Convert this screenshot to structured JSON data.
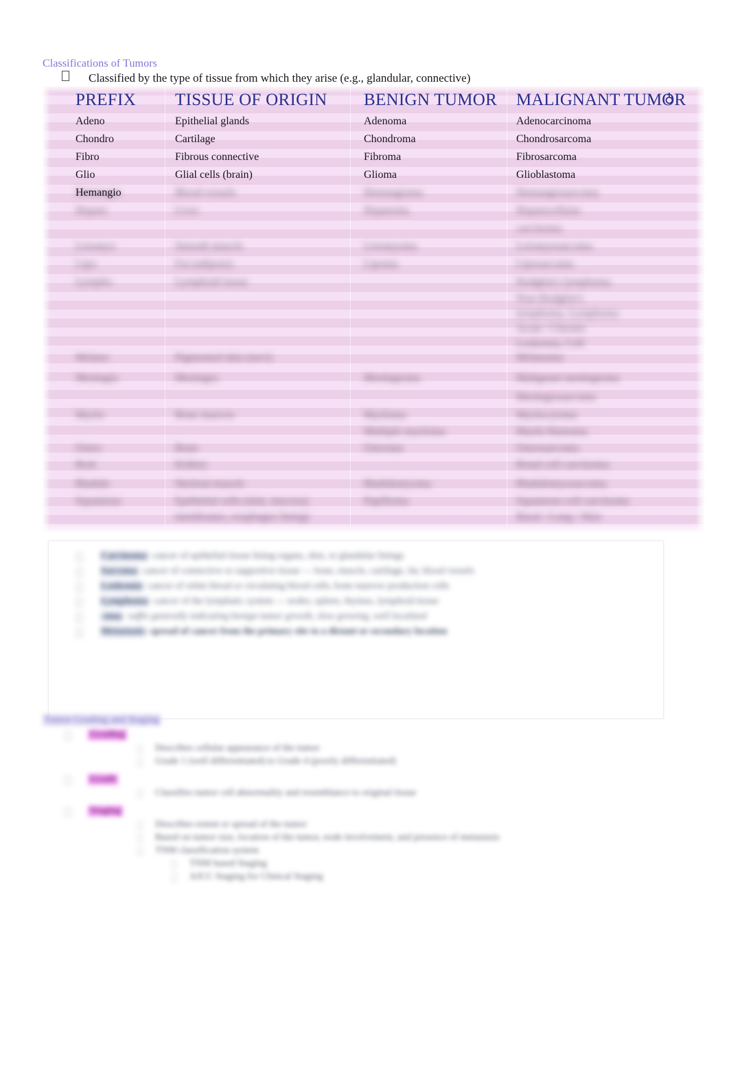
{
  "document": {
    "title": "Classifications of Tumors",
    "intro_bullet_glyph": "tofu-box-glyph",
    "intro_text": "Classified by the type of tissue from which they arise (e.g., glandular, connective)"
  },
  "table": {
    "headers": {
      "prefix": "PREFIX",
      "tissue": "TISSUE OF ORIGIN",
      "benign": "BENIGN TUMOR",
      "malignant": "MALIGNANT TUMOR"
    },
    "glyph_artifact": "♁",
    "rows": [
      {
        "prefix": "Adeno",
        "tissue": "Epithelial glands",
        "benign": "Adenoma",
        "malignant": "Adenocarcinoma"
      },
      {
        "prefix": "Chondro",
        "tissue": "Cartilage",
        "benign": "Chondroma",
        "malignant": "Chondrosarcoma"
      },
      {
        "prefix": "Fibro",
        "tissue": "Fibrous connective",
        "benign": "Fibroma",
        "malignant": "Fibrosarcoma"
      },
      {
        "prefix": "Glio",
        "tissue": "Glial cells (brain)",
        "benign": "Glioma",
        "malignant": "Glioblastoma"
      },
      {
        "prefix": "Hemangio",
        "tissue": "Blood vessels",
        "benign": "Hemangioma",
        "malignant": "Hemangiosarcoma"
      }
    ],
    "obscured_rows": [
      {
        "prefix": "Hepato",
        "tissue": "Liver",
        "benign": "Hepatoma",
        "malignant": "Hepatocellular"
      },
      {
        "prefix": "",
        "tissue": "",
        "benign": "",
        "malignant": "carcinoma"
      },
      {
        "prefix": "Leiomyo",
        "tissue": "Smooth muscle",
        "benign": "Leiomyoma",
        "malignant": "Leiomyosarcoma"
      },
      {
        "prefix": "Lipo",
        "tissue": "Fat (adipose)",
        "benign": "Lipoma",
        "malignant": "Liposarcoma"
      },
      {
        "prefix": "Lympho",
        "tissue": "Lymphoid tissue",
        "benign": "",
        "malignant": "Hodgkin's lymphoma"
      },
      {
        "prefix": "",
        "tissue": "",
        "benign": "",
        "malignant": "Non-Hodgkin's"
      },
      {
        "prefix": "",
        "tissue": "",
        "benign": "",
        "malignant": "lymphoma, Lymphoma"
      },
      {
        "prefix": "",
        "tissue": "",
        "benign": "",
        "malignant": "Acute / Chronic"
      },
      {
        "prefix": "",
        "tissue": "",
        "benign": "",
        "malignant": "Leukemia, Cell"
      },
      {
        "prefix": "Melano",
        "tissue": "Pigmented skin (nevi)",
        "benign": "",
        "malignant": "Melanoma"
      },
      {
        "prefix": "Meningio",
        "tissue": "Meninges",
        "benign": "Meningioma",
        "malignant": "Malignant meningioma"
      },
      {
        "prefix": "",
        "tissue": "",
        "benign": "",
        "malignant": "Meningiosarcoma"
      },
      {
        "prefix": "Myelo",
        "tissue": "Bone marrow",
        "benign": "Myeloma",
        "malignant": "Myelocytoma"
      },
      {
        "prefix": "",
        "tissue": "",
        "benign": "Multiple myeloma",
        "malignant": "Myelo blastoma"
      },
      {
        "prefix": "Osteo",
        "tissue": "Bone",
        "benign": "Osteoma",
        "malignant": "Osteosarcoma"
      },
      {
        "prefix": "Reni",
        "tissue": "Kidney",
        "benign": "",
        "malignant": "Renal cell carcinoma"
      },
      {
        "prefix": "Rhabdo",
        "tissue": "Skeletal muscle",
        "benign": "Rhabdomyoma",
        "malignant": "Rhabdomyosarcoma"
      },
      {
        "prefix": "Squamous",
        "tissue": "Epithelial cells (skin, mucosa)",
        "benign": "Papilloma",
        "malignant": "Squamous cell carcinoma"
      },
      {
        "prefix": "",
        "tissue": "membranes, esophagus lining)",
        "benign": "",
        "malignant": "Basal / Lung / Skin"
      }
    ]
  },
  "panel": {
    "items": [
      {
        "lead": "Carcinoma",
        "rest": ": cancer of epithelial tissue lining organs, skin, or glandular linings"
      },
      {
        "lead": "Sarcoma",
        "rest": ": cancer of connective or supportive tissue — bone, muscle, cartilage, fat, blood vessels"
      },
      {
        "lead": "Leukemia",
        "rest": ": cancer of white blood or circulating blood cells, bone marrow production cells"
      },
      {
        "lead": "Lymphoma",
        "rest": ": cancer of the lymphatic system — nodes, spleen, thymus, lymphoid tissue"
      },
      {
        "lead": "-oma",
        "rest": ": suffix generally indicating benign tumor growth, slow growing, well localized"
      },
      {
        "lead": "Metastasis",
        "rest": ": spread of cancer from the primary site to a distant or secondary location"
      }
    ]
  },
  "lower": {
    "heading": "Tumor Grading and Staging",
    "groups": [
      {
        "label": "Grading",
        "lines": [
          {
            "text": "Describes cellular appearance of the tumor"
          },
          {
            "text": "Grade 1 (well differentiated) to Grade 4 (poorly differentiated)"
          }
        ]
      },
      {
        "label": "Grade",
        "lines": [
          {
            "text": "Classifies tumor cell abnormality and resemblance to original tissue"
          }
        ]
      },
      {
        "label": "Staging",
        "lines": [
          {
            "text": "Describes extent or spread of the tumor"
          },
          {
            "text": "Based on tumor size, location of the tumor, node involvement, and presence of metastasis"
          },
          {
            "text": "TNM classification system"
          }
        ],
        "sublines": [
          {
            "text": "TNM based Staging"
          },
          {
            "text": "AJCC Staging for Clinical Staging"
          }
        ]
      }
    ]
  }
}
